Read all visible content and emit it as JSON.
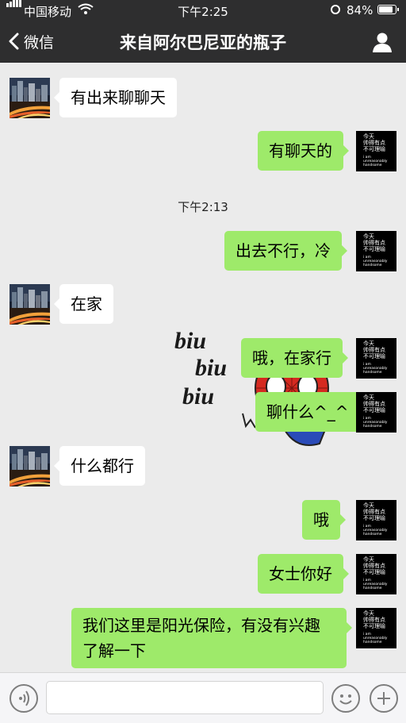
{
  "status_bar": {
    "carrier": "中国移动",
    "time": "下午2:25",
    "battery": "84%"
  },
  "nav": {
    "back_label": "微信",
    "title": "来自阿尔巴尼亚的瓶子"
  },
  "self_avatar_text": [
    "今天",
    "帅得有点",
    "不可理喻",
    "i am",
    "unreasonably",
    "handsome"
  ],
  "messages": [
    {
      "side": "left",
      "text": "有出来聊聊天"
    },
    {
      "side": "right",
      "text": "有聊天的"
    },
    {
      "type": "time",
      "text": "下午2:13"
    },
    {
      "side": "right",
      "text": "出去不行，冷"
    },
    {
      "side": "left",
      "text": "在家"
    },
    {
      "side": "right",
      "text": "哦，在家行"
    },
    {
      "side": "right",
      "text": "聊什么^_^"
    },
    {
      "side": "left",
      "text": "什么都行"
    },
    {
      "side": "right",
      "text": "哦"
    },
    {
      "side": "right",
      "text": "女士你好"
    },
    {
      "side": "right",
      "text": "我们这里是阳光保险，有没有兴趣了解一下"
    }
  ],
  "sticker": {
    "words": [
      "biu",
      "biu",
      "biu"
    ]
  },
  "colors": {
    "header": "#2e2e2f",
    "chat_bg": "#ebebeb",
    "self_bubble": "#9eea6a",
    "other_bubble": "#ffffff"
  },
  "icons": {
    "back": "chevron-left",
    "profile": "person",
    "voice": "voice-wave",
    "emoji": "smile",
    "more": "plus"
  }
}
